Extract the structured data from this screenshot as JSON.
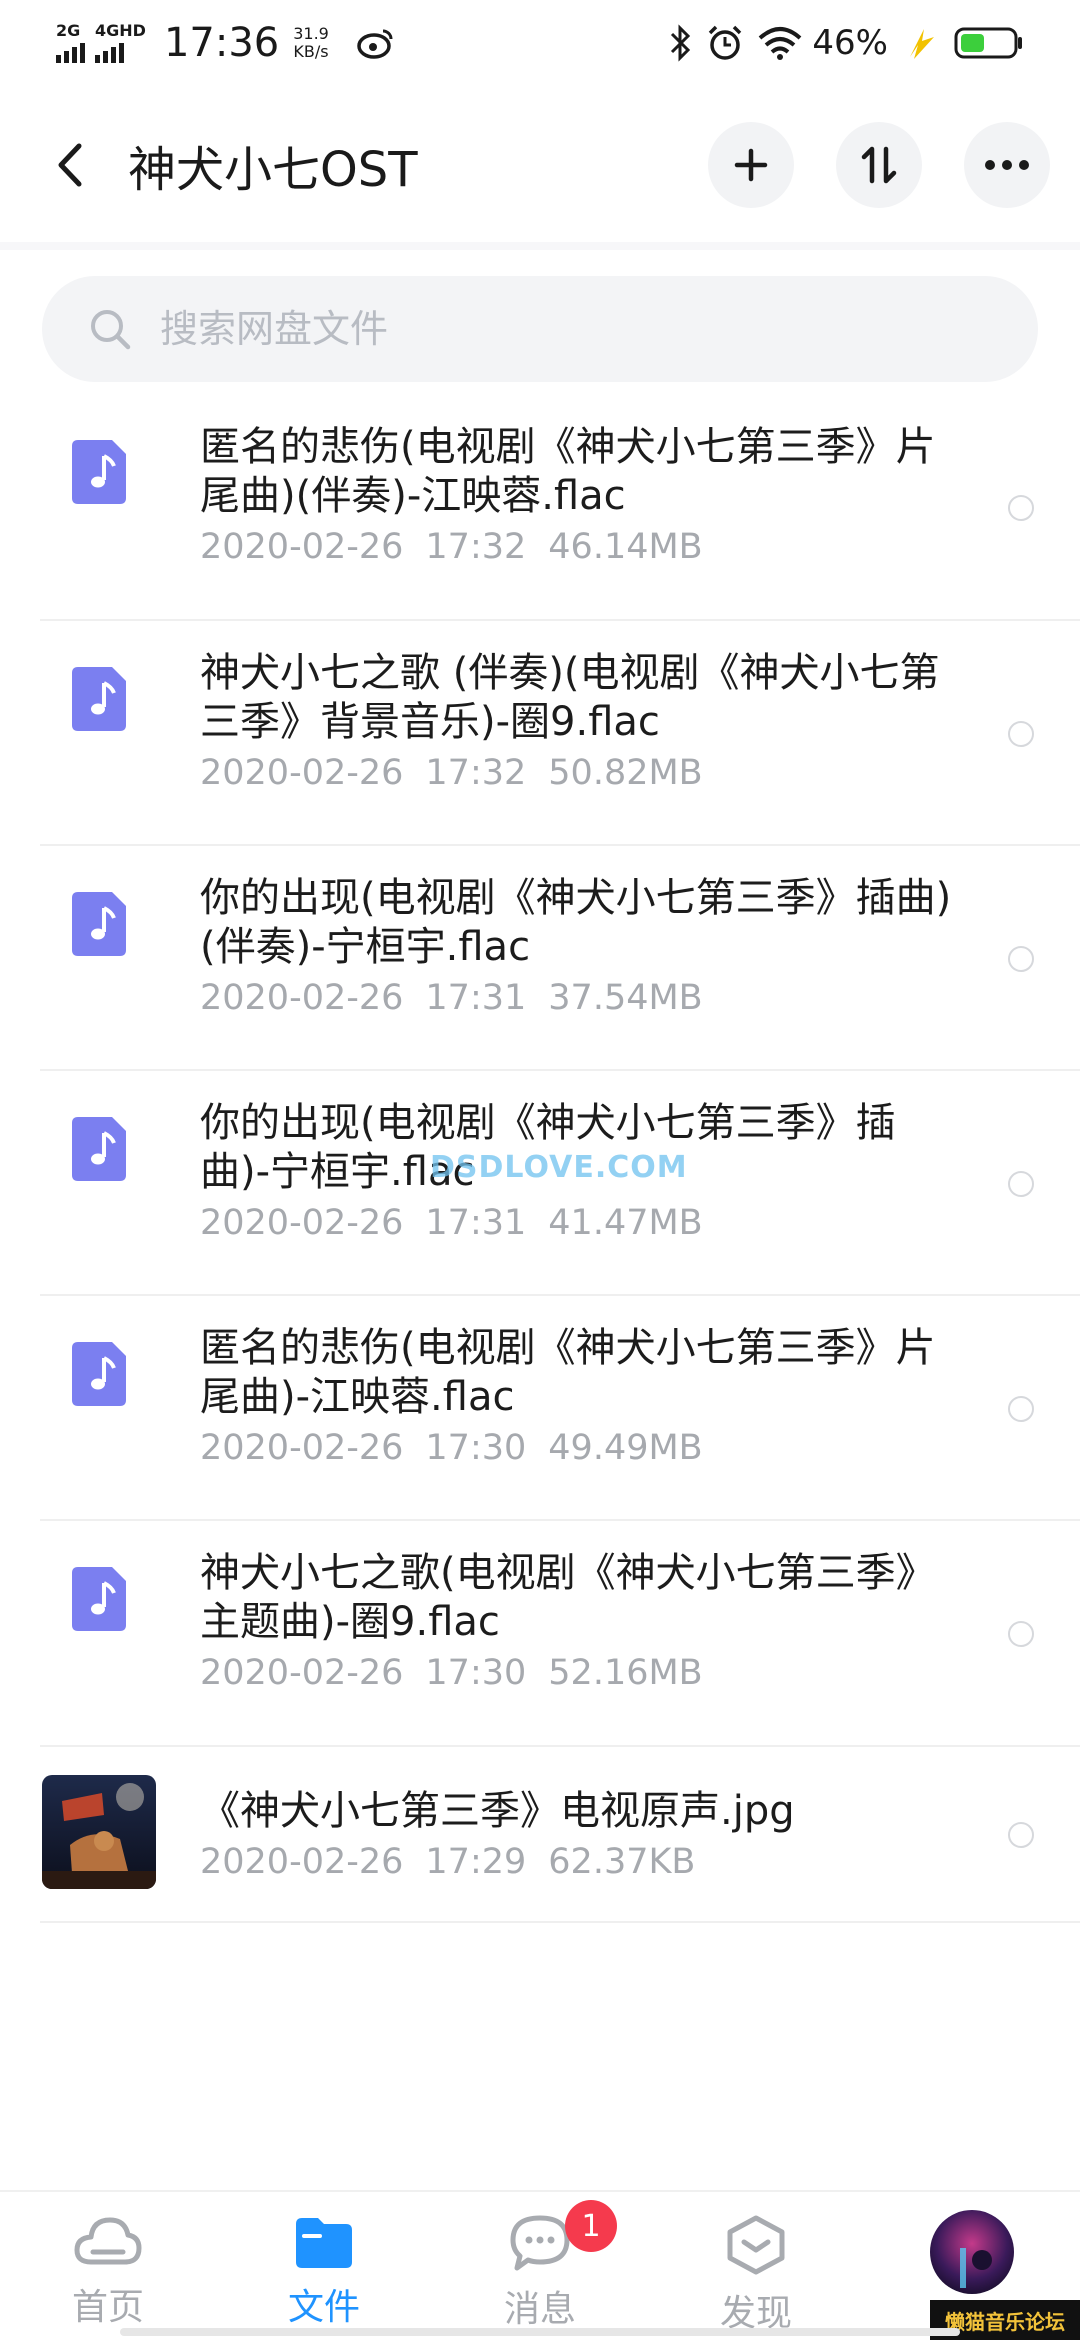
{
  "status_bar": {
    "net1": "2G",
    "net2": "4GHD",
    "time": "17:36",
    "speed_value": "31.9",
    "speed_unit": "KB/s",
    "battery_pct": "46%",
    "icons": [
      "weibo-icon",
      "bluetooth-icon",
      "alarm-icon",
      "wifi-icon",
      "charging-icon",
      "battery-icon"
    ],
    "battery_level": 0.46,
    "battery_color": "#3ccf3c"
  },
  "app_bar": {
    "title": "神犬小七OST",
    "icons": [
      "back-icon",
      "add-icon",
      "sort-icon",
      "more-icon"
    ]
  },
  "search": {
    "placeholder": "搜索网盘文件",
    "value": ""
  },
  "files": [
    {
      "name": "匿名的悲伤(电视剧《神犬小七第三季》片尾曲)(伴奏)-江映蓉.flac",
      "date": "2020-02-26",
      "time": "17:32",
      "size": "46.14MB",
      "icon": "music-file-icon"
    },
    {
      "name": "神犬小七之歌 (伴奏)(电视剧《神犬小七第三季》背景音乐)-圈9.flac",
      "date": "2020-02-26",
      "time": "17:32",
      "size": "50.82MB",
      "icon": "music-file-icon"
    },
    {
      "name": "你的出现(电视剧《神犬小七第三季》插曲)(伴奏)-宁桓宇.flac",
      "date": "2020-02-26",
      "time": "17:31",
      "size": "37.54MB",
      "icon": "music-file-icon"
    },
    {
      "name": "你的出现(电视剧《神犬小七第三季》插曲)-宁桓宇.flac",
      "date": "2020-02-26",
      "time": "17:31",
      "size": "41.47MB",
      "icon": "music-file-icon"
    },
    {
      "name": "匿名的悲伤(电视剧《神犬小七第三季》片尾曲)-江映蓉.flac",
      "date": "2020-02-26",
      "time": "17:30",
      "size": "49.49MB",
      "icon": "music-file-icon"
    },
    {
      "name": "神犬小七之歌(电视剧《神犬小七第三季》主题曲)-圈9.flac",
      "date": "2020-02-26",
      "time": "17:30",
      "size": "52.16MB",
      "icon": "music-file-icon"
    },
    {
      "name": "《神犬小七第三季》电视原声.jpg",
      "date": "2020-02-26",
      "time": "17:29",
      "size": "62.37KB",
      "icon": "image-thumbnail"
    }
  ],
  "watermark": "DSDLOVE.COM",
  "bottom_nav": {
    "items": [
      {
        "label": "首页",
        "icon": "cloud-icon",
        "active": false
      },
      {
        "label": "文件",
        "icon": "folder-icon",
        "active": true
      },
      {
        "label": "消息",
        "icon": "chat-icon",
        "active": false,
        "badge": "1"
      },
      {
        "label": "发现",
        "icon": "discover-icon",
        "active": false
      }
    ],
    "active_color": "#1f93ff",
    "inactive_color": "#a8abb0",
    "forum_badge": "懒猫音乐论坛"
  },
  "accent_color": "#7b7ff0"
}
